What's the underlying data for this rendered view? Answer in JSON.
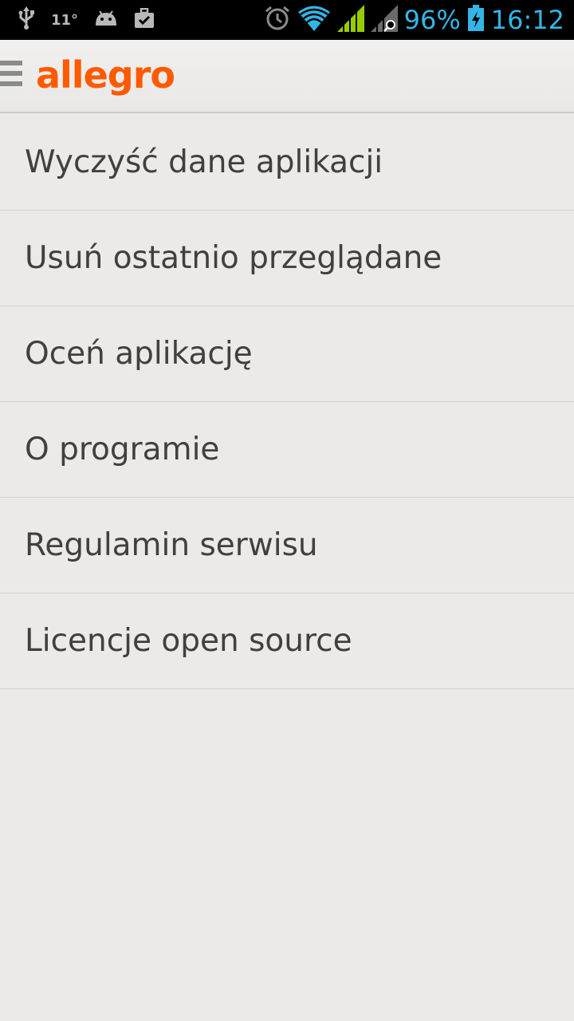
{
  "status_bar": {
    "temperature": "11°",
    "battery_percent": "96%",
    "time": "16:12",
    "icons": [
      "usb-icon",
      "android-icon",
      "briefcase-check-icon",
      "alarm-icon",
      "wifi-icon",
      "cell-signal-icon",
      "cell-signal-roaming-icon",
      "battery-charging-icon"
    ],
    "accent_color": "#33b5e5"
  },
  "action_bar": {
    "logo_text": "allegro",
    "logo_color": "#ff5a00",
    "menu_icon": "hamburger-icon"
  },
  "menu": {
    "items": [
      {
        "label": "Wyczyść dane aplikacji"
      },
      {
        "label": "Usuń ostatnio przeglądane"
      },
      {
        "label": "Oceń aplikację"
      },
      {
        "label": "O programie"
      },
      {
        "label": "Regulamin serwisu"
      },
      {
        "label": "Licencje open source"
      }
    ]
  }
}
